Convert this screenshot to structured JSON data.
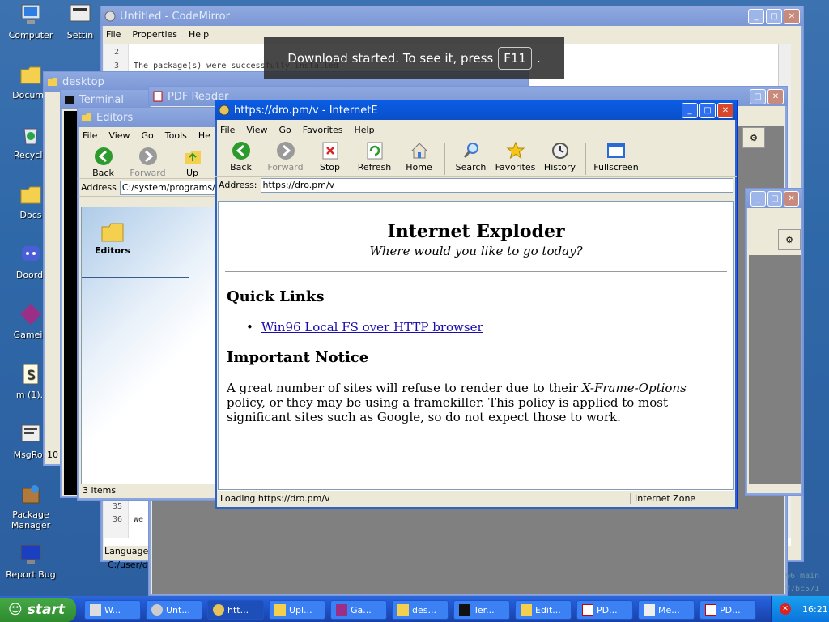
{
  "desktop_icons": [
    {
      "label": "Computer",
      "icon": "computer-icon"
    },
    {
      "label": "Settin",
      "icon": "settings-icon"
    },
    {
      "label": "Docume",
      "icon": "documents-icon"
    },
    {
      "label": "Recycle",
      "icon": "recycle-bin-icon"
    },
    {
      "label": "Docs",
      "icon": "folder-icon"
    },
    {
      "label": "Doordi",
      "icon": "doordie-icon"
    },
    {
      "label": "Gamein",
      "icon": "game-icon"
    },
    {
      "label": "m (1).j",
      "icon": "script-file-icon"
    },
    {
      "label": "MsgRoo",
      "icon": "msgroom-icon"
    },
    {
      "label": "Package Manager",
      "icon": "package-icon"
    },
    {
      "label": "Report Bug",
      "icon": "report-bug-icon"
    }
  ],
  "codemirror": {
    "title": "Untitled - CodeMirror",
    "menu": [
      "File",
      "Properties",
      "Help"
    ],
    "line_numbers": [
      "2",
      "3"
    ],
    "lines": [
      "",
      "The package(s) were successfully installed"
    ],
    "bottom_line_numbers": [
      "35",
      "36"
    ],
    "bottom_lines": [
      "",
      "We"
    ],
    "language_label": "Language:",
    "path": "C:/user/de"
  },
  "desktop_folder": {
    "title": "desktop",
    "status": "10 i"
  },
  "terminal": {
    "title": "Terminal"
  },
  "pdf_reader": {
    "title": "PDF Reader",
    "footer_text": "96 main",
    "footer_text2": "f7bc571"
  },
  "editors": {
    "title": "Editors",
    "menu": [
      "File",
      "View",
      "Go",
      "Tools",
      "He"
    ],
    "back": "Back",
    "forward": "Forward",
    "up": "Up",
    "address_label": "Address",
    "address": "C:/system/programs/Accessories",
    "folder_label": "Editors",
    "status": "3 items"
  },
  "ie": {
    "title": "https://dro.pm/v - InternetE",
    "menu": [
      "File",
      "View",
      "Go",
      "Favorites",
      "Help"
    ],
    "toolbar": {
      "back": "Back",
      "forward": "Forward",
      "stop": "Stop",
      "refresh": "Refresh",
      "home": "Home",
      "search": "Search",
      "favorites": "Favorites",
      "history": "History",
      "fullscreen": "Fullscreen"
    },
    "address_label": "Address:",
    "address": "https://dro.pm/v",
    "page": {
      "heading": "Internet Exploder",
      "tagline": "Where would you like to go today?",
      "quick_links": "Quick Links",
      "link": "Win96 Local FS over HTTP browser",
      "notice_heading": "Important Notice",
      "notice_pre": "A great number of sites will refuse to render due to their ",
      "notice_em": "X-Frame-Options",
      "notice_post": " policy, or they may be using a framekiller. This policy is applied to most significant sites such as Google, so do not expect those to work."
    },
    "status": "Loading https://dro.pm/v",
    "zone": "Internet Zone"
  },
  "toast": {
    "pre": "Download started. To see it, press",
    "key": "F11",
    "post": "."
  },
  "taskbar": {
    "start": "start",
    "tasks": [
      "W...",
      "Unt...",
      "htt...",
      "Upl...",
      "Ga...",
      "des...",
      "Ter...",
      "Edit...",
      "PD...",
      "Me...",
      "PD..."
    ],
    "time": "16:21"
  }
}
